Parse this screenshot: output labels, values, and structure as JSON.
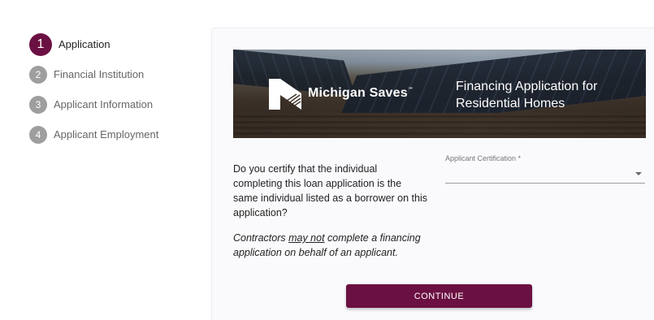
{
  "stepper": {
    "steps": [
      {
        "number": "1",
        "label": "Application",
        "active": true
      },
      {
        "number": "2",
        "label": "Financial Institution",
        "active": false
      },
      {
        "number": "3",
        "label": "Applicant Information",
        "active": false
      },
      {
        "number": "4",
        "label": "Applicant Employment",
        "active": false
      }
    ]
  },
  "banner": {
    "brand": "Michigan Saves",
    "trademark": "℠",
    "title": "Financing Application for Residential Homes"
  },
  "form": {
    "question": "Do you certify that the individual completing this loan application is the same individual listed as a borrower on this application?",
    "note_prefix": "Contractors ",
    "note_emphasis": "may not",
    "note_suffix": " complete a financing application on behalf of an applicant.",
    "certification_label": "Applicant Certification *",
    "certification_value": ""
  },
  "actions": {
    "continue_label": "CONTINUE"
  },
  "colors": {
    "brand": "#6b1042",
    "inactive_step": "#9e9e9e"
  },
  "icons": {
    "select_arrow": "caret-down-icon",
    "logo": "michigan-saves-logo-icon"
  }
}
